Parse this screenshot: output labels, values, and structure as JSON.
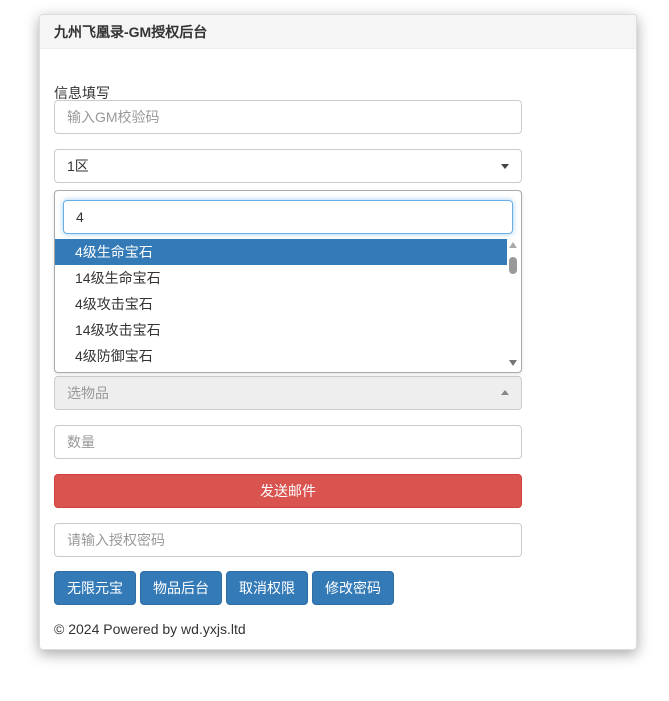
{
  "header": {
    "title": "九州飞凰录-GM授权后台"
  },
  "form": {
    "section_label": "信息填写",
    "gm_code_placeholder": "输入GM校验码",
    "server_select_value": "1区",
    "item_select_placeholder": "选物品",
    "quantity_placeholder": "数量",
    "send_mail_label": "发送邮件",
    "auth_password_placeholder": "请输入授权密码"
  },
  "dropdown": {
    "search_value": "4",
    "options": [
      {
        "label": "4级生命宝石",
        "active": true
      },
      {
        "label": "14级生命宝石",
        "active": false
      },
      {
        "label": "4级攻击宝石",
        "active": false
      },
      {
        "label": "14级攻击宝石",
        "active": false
      },
      {
        "label": "4级防御宝石",
        "active": false
      }
    ]
  },
  "buttons": {
    "unlimited_yuanbao": "无限元宝",
    "item_backend": "物品后台",
    "revoke_permission": "取消权限",
    "change_password": "修改密码"
  },
  "footer": {
    "text": "© 2024 Powered by wd.yxjs.ltd"
  },
  "colors": {
    "primary": "#337ab7",
    "danger": "#d9534f",
    "selected_option": "#337ab7"
  }
}
